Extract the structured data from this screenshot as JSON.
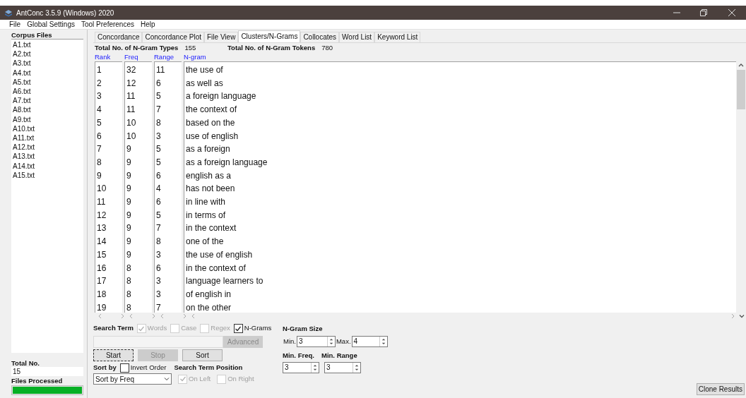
{
  "window": {
    "title": "AntConc 3.5.9 (Windows) 2020"
  },
  "menu": [
    "File",
    "Global Settings",
    "Tool Preferences",
    "Help"
  ],
  "sidebar": {
    "title": "Corpus Files",
    "files": [
      "A1.txt",
      "A2.txt",
      "A3.txt",
      "A4.txt",
      "A5.txt",
      "A6.txt",
      "A7.txt",
      "A8.txt",
      "A9.txt",
      "A10.txt",
      "A11.txt",
      "A12.txt",
      "A13.txt",
      "A14.txt",
      "A15.txt"
    ],
    "total_label": "Total No.",
    "total_value": "15",
    "processed_label": "Files Processed",
    "progress": {
      "level": 1
    }
  },
  "tabs": [
    {
      "label": "Concordance",
      "selected": false
    },
    {
      "label": "Concordance Plot",
      "selected": false
    },
    {
      "label": "File View",
      "selected": false
    },
    {
      "label": "Clusters/N-Grams",
      "selected": true
    },
    {
      "label": "Collocates",
      "selected": false
    },
    {
      "label": "Word List",
      "selected": false
    },
    {
      "label": "Keyword List",
      "selected": false
    }
  ],
  "summary": [
    {
      "label": "Total No. of N-Gram Types",
      "value": "155"
    },
    {
      "label": "Total No. of N-Gram Tokens",
      "value": "780"
    }
  ],
  "table": {
    "columns": [
      "Rank",
      "Freq",
      "Range",
      "N-gram"
    ],
    "rows": [
      [
        "1",
        "32",
        "11",
        "the use of"
      ],
      [
        "2",
        "12",
        "6",
        "as well as"
      ],
      [
        "3",
        "11",
        "5",
        "a foreign language"
      ],
      [
        "4",
        "11",
        "7",
        "the context of"
      ],
      [
        "5",
        "10",
        "8",
        "based on the"
      ],
      [
        "6",
        "10",
        "3",
        "use of english"
      ],
      [
        "7",
        "9",
        "5",
        "as a foreign"
      ],
      [
        "8",
        "9",
        "5",
        "as a foreign language"
      ],
      [
        "9",
        "9",
        "6",
        "english as a"
      ],
      [
        "10",
        "9",
        "4",
        "has not been"
      ],
      [
        "11",
        "9",
        "6",
        "in line with"
      ],
      [
        "12",
        "9",
        "5",
        "in terms of"
      ],
      [
        "13",
        "9",
        "7",
        "in the context"
      ],
      [
        "14",
        "9",
        "8",
        "one of the"
      ],
      [
        "15",
        "9",
        "3",
        "the use of english"
      ],
      [
        "16",
        "8",
        "6",
        "in the context of"
      ],
      [
        "17",
        "8",
        "3",
        "language learners to"
      ],
      [
        "18",
        "8",
        "3",
        "of english in"
      ],
      [
        "19",
        "8",
        "7",
        "on the other"
      ]
    ]
  },
  "search": {
    "label": "Search Term",
    "options": [
      {
        "label": "Words",
        "checked": true,
        "disabled": true
      },
      {
        "label": "Case",
        "checked": false,
        "disabled": true
      },
      {
        "label": "Regex",
        "checked": false,
        "disabled": true
      },
      {
        "label": "N-Grams",
        "checked": true,
        "disabled": false
      }
    ],
    "advanced": {
      "label": "Advanced",
      "disabled": true
    }
  },
  "buttons": [
    {
      "label": "Start",
      "disabled": false
    },
    {
      "label": "Stop",
      "disabled": true
    },
    {
      "label": "Sort",
      "disabled": false
    }
  ],
  "sort": {
    "label": "Sort by",
    "invert": {
      "label": "Invert Order",
      "checked": false
    },
    "value": "Sort by Freq"
  },
  "position": {
    "label": "Search Term Position",
    "options": [
      {
        "label": "On Left",
        "checked": true,
        "disabled": true
      },
      {
        "label": "On Right",
        "checked": false,
        "disabled": true
      }
    ]
  },
  "ngram_size": {
    "title": "N-Gram Size",
    "min_label": "Min.",
    "min_value": "3",
    "max_label": "Max.",
    "max_value": "4"
  },
  "thresholds": [
    {
      "label": "Min. Freq.",
      "value": "3"
    },
    {
      "label": "Min. Range",
      "value": "3"
    }
  ],
  "clone_button": "Clone Results"
}
